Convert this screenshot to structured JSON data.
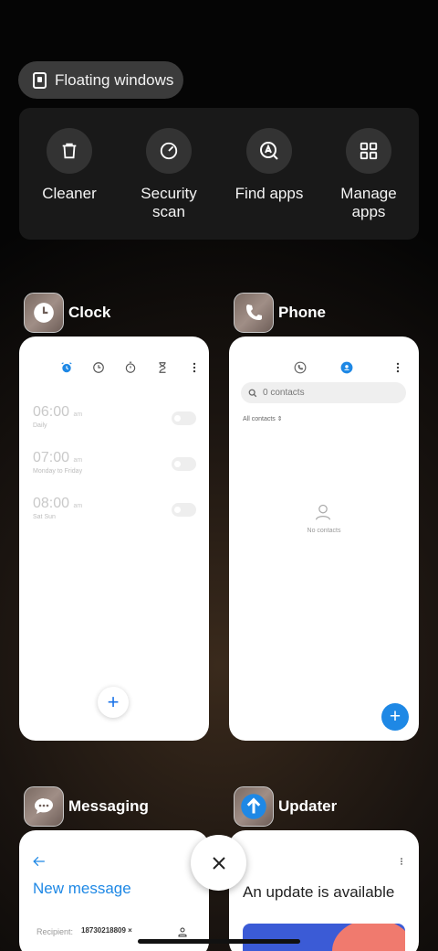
{
  "floating_windows": {
    "label": "Floating windows",
    "icon": "floating-window-icon"
  },
  "quick_actions": [
    {
      "label": "Cleaner",
      "icon": "trash-icon"
    },
    {
      "label": "Security\nscan",
      "icon": "security-scan-icon"
    },
    {
      "label": "Find apps",
      "icon": "find-apps-icon"
    },
    {
      "label": "Manage\napps",
      "icon": "grid-icon"
    }
  ],
  "clock_card": {
    "title": "Clock",
    "tabs": [
      "alarm-icon",
      "clock-icon",
      "stopwatch-icon",
      "timer-icon",
      "more-icon"
    ],
    "alarms": [
      {
        "time": "06:00",
        "ampm": "am",
        "label": "Daily"
      },
      {
        "time": "07:00",
        "ampm": "am",
        "label": "Monday to Friday"
      },
      {
        "time": "08:00",
        "ampm": "am",
        "label": "Sat Sun"
      }
    ],
    "add_label": "+"
  },
  "phone_card": {
    "title": "Phone",
    "search_placeholder": "0 contacts",
    "filter_label": "All contacts",
    "empty_label": "No contacts",
    "add_label": "+"
  },
  "messaging_card": {
    "title": "Messaging",
    "heading": "New message",
    "recipient_label": "Recipient:",
    "recipient_value": "18730218809 ×"
  },
  "updater_card": {
    "title": "Updater",
    "heading": "An update is available"
  },
  "colors": {
    "accent_blue": "#1e88e5",
    "panel": "#191919",
    "pill": "#3b3b3b"
  }
}
